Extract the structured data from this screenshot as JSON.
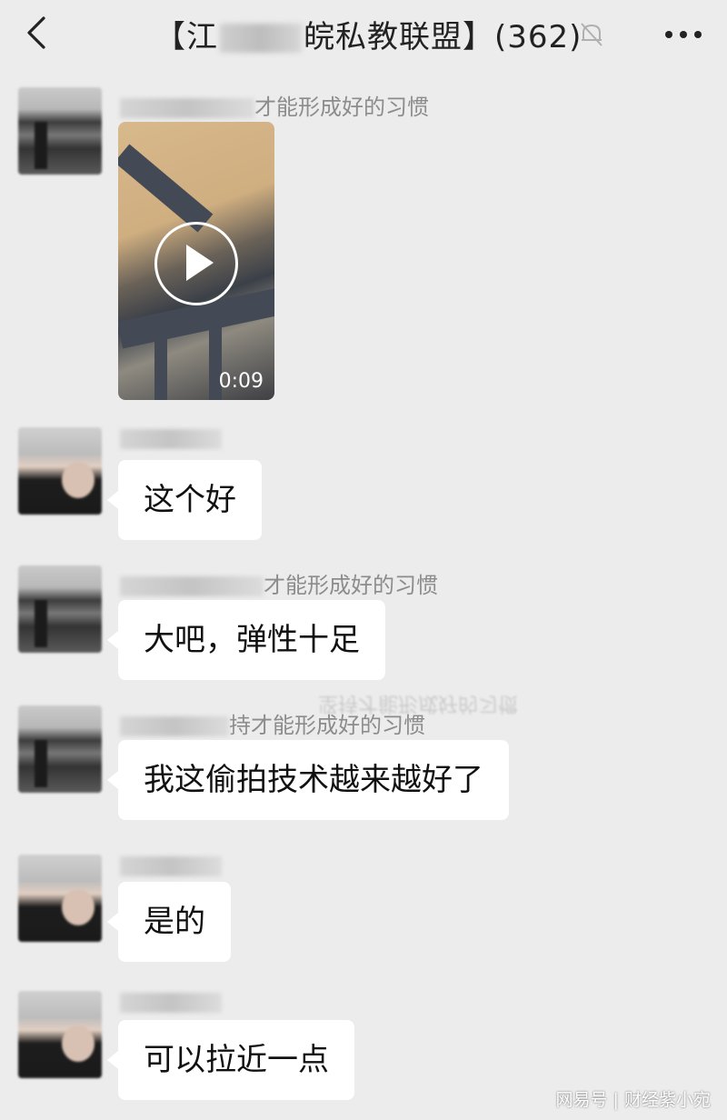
{
  "header": {
    "back_icon": "chevron-left-icon",
    "title_prefix": "【江",
    "title_suffix": "皖私教联盟】(362)",
    "muted_icon": "bell-off-icon",
    "more_icon": "more-dots-icon"
  },
  "messages": [
    {
      "sender_tail": "才能形成好的习惯",
      "type": "video",
      "duration": "0:09"
    },
    {
      "sender_tail": "",
      "text": "这个好"
    },
    {
      "sender_tail": "才能形成好的习惯",
      "text": "大吧，弹性十足"
    },
    {
      "sender_tail": "持才能形成好的习惯",
      "text": "我这偷拍技术越来越好了"
    },
    {
      "sender_tail": "",
      "text": "是的"
    },
    {
      "sender_tail": "",
      "text": "可以拉近一点"
    }
  ],
  "overlay": {
    "ghost_text": "坚持才能形成好的习惯",
    "watermark": "网易号 | 财经紫小宛"
  }
}
